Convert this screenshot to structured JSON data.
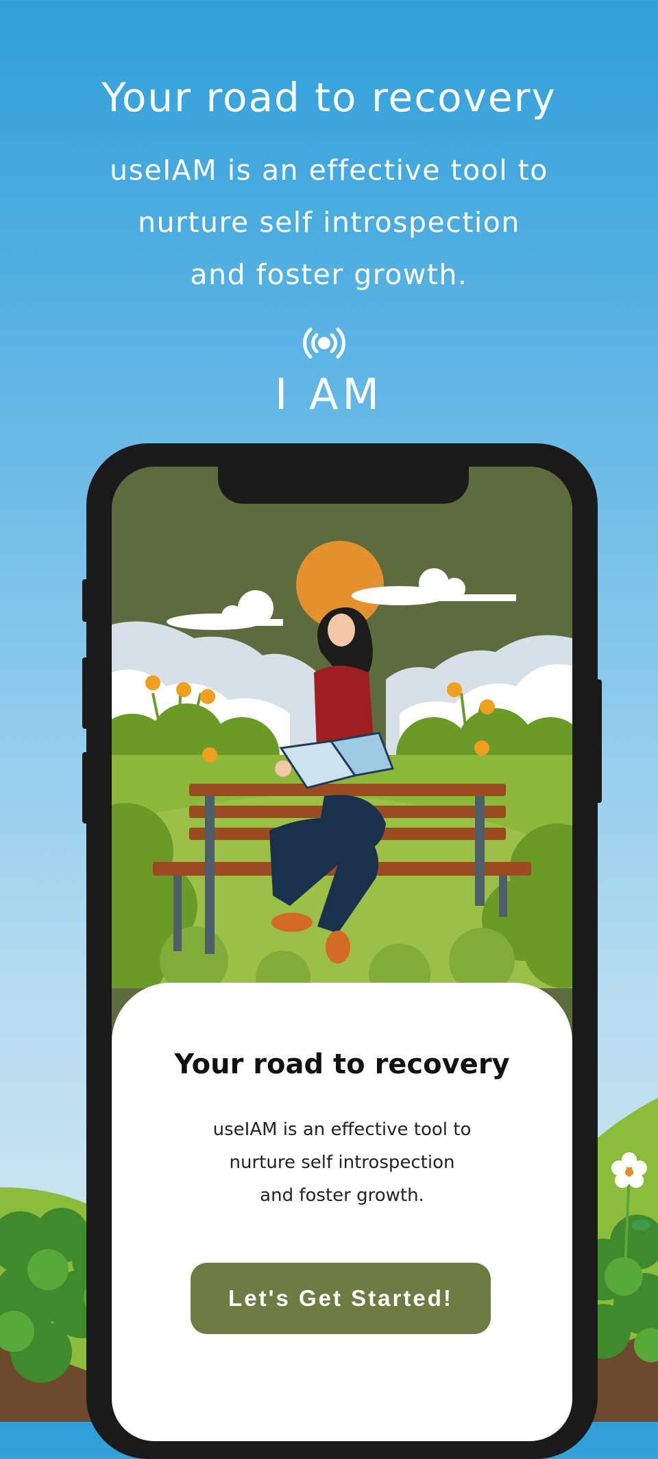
{
  "hero": {
    "title": "Your road to recovery",
    "subtitle_lines": [
      "useIAM is an effective tool to",
      "nurture self introspection",
      "and foster growth."
    ]
  },
  "logo": {
    "icon": "broadcast-signal-icon",
    "text": "I AM"
  },
  "phone_screen": {
    "card": {
      "title": "Your road to recovery",
      "subtitle_lines": [
        "useIAM is an effective tool to",
        "nurture self introspection",
        "and foster growth."
      ],
      "cta_label": "Let's Get Started!"
    }
  },
  "colors": {
    "sky_top": "#2f9fd8",
    "sky_bottom": "#c9e5f2",
    "screen_olive": "#5e6b3e",
    "button_olive": "#6f7b45",
    "sun_orange": "#e2912e"
  }
}
